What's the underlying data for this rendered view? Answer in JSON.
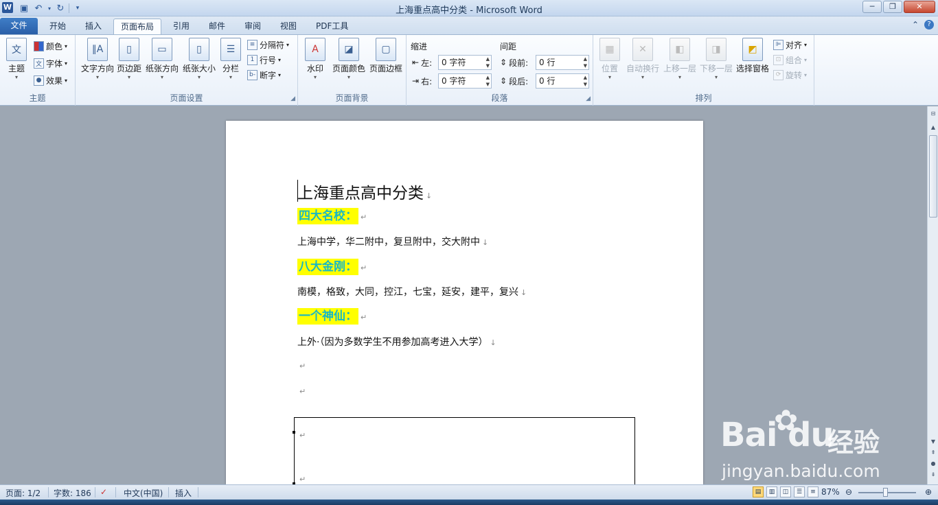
{
  "window": {
    "title": "上海重点高中分类 - Microsoft Word",
    "app_icon_letter": "W",
    "controls": [
      "─",
      "❐",
      "✕"
    ]
  },
  "tabs": {
    "file": "文件",
    "items": [
      "开始",
      "插入",
      "页面布局",
      "引用",
      "邮件",
      "审阅",
      "视图",
      "PDF工具"
    ],
    "active": "页面布局"
  },
  "ribbon": {
    "theme": {
      "label": "主题",
      "main": "主题",
      "colors": "颜色",
      "fonts": "字体",
      "effects": "效果"
    },
    "page_setup": {
      "label": "页面设置",
      "text_direction": "文字方向",
      "margins": "页边距",
      "orientation": "纸张方向",
      "size": "纸张大小",
      "columns": "分栏",
      "breaks": "分隔符",
      "line_numbers": "行号",
      "hyphenation": "断字"
    },
    "page_background": {
      "label": "页面背景",
      "watermark": "水印",
      "page_color": "页面颜色",
      "page_borders": "页面边框"
    },
    "paragraph": {
      "label": "段落",
      "indent_title": "缩进",
      "spacing_title": "间距",
      "left_label": "左:",
      "left_value": "0 字符",
      "right_label": "右:",
      "right_value": "0 字符",
      "before_label": "段前:",
      "before_value": "0 行",
      "after_label": "段后:",
      "after_value": "0 行"
    },
    "arrange": {
      "label": "排列",
      "position": "位置",
      "wrap_text": "自动换行",
      "bring_forward": "上移一层",
      "send_backward": "下移一层",
      "selection_pane": "选择窗格",
      "align": "对齐",
      "group": "组合",
      "rotate": "旋转"
    }
  },
  "document": {
    "title": "上海重点高中分类",
    "heading1": "四大名校：",
    "line1": "上海中学，华二附中，复旦附中，交大附中",
    "heading2": "八大金刚：",
    "line2": "南模，格致，大同，控江，七宝，延安，建平，复兴",
    "heading3": "一个神仙：",
    "line3": "上外·（因为多数学生不用参加高考进入大学）",
    "para_mark": "↵",
    "line_mark": "↓",
    "heading_color": "#19b8c4",
    "highlight_color": "#ffff00"
  },
  "statusbar": {
    "page": "页面: 1/2",
    "words": "字数: 186",
    "language": "中文(中国)",
    "mode": "插入",
    "zoom": "87%",
    "zoom_percent": 87
  },
  "watermark": {
    "brand": "Bai du",
    "cn": "经验",
    "url": "jingyan.baidu.com"
  }
}
